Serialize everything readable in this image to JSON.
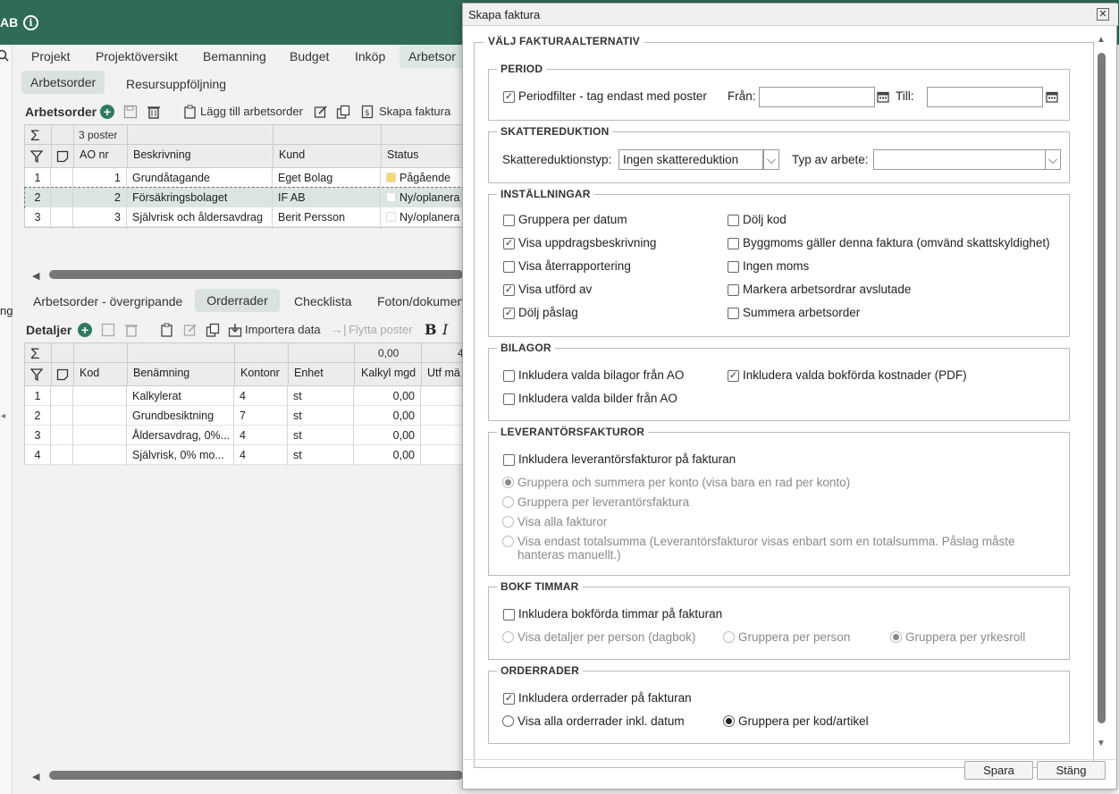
{
  "app": {
    "company": "AB"
  },
  "tabs": [
    "Projekt",
    "Projektöversikt",
    "Bemanning",
    "Budget",
    "Inköp",
    "Arbetsor"
  ],
  "subtabs": [
    "Arbetsorder",
    "Resursuppföljning"
  ],
  "ao_section": {
    "title": "Arbetsorder",
    "add_label": "Lägg till arbetsorder",
    "invoice_label": "Skapa faktura",
    "count": "3 poster",
    "columns": [
      "AO nr",
      "Beskrivning",
      "Kund",
      "Status"
    ],
    "rows": [
      {
        "idx": "1",
        "nr": "1",
        "desc": "Grundåtagande",
        "kund": "Eget Bolag",
        "status": "Pågående",
        "color": "#f1dc6a"
      },
      {
        "idx": "2",
        "nr": "2",
        "desc": "Försäkringsbolaget",
        "kund": "IF AB",
        "status": "Ny/oplanera",
        "color": "#ffffff"
      },
      {
        "idx": "3",
        "nr": "3",
        "desc": "Självrisk och åldersavdrag",
        "kund": "Berit Persson",
        "status": "Ny/oplanera",
        "color": "#ffffff"
      }
    ]
  },
  "detail_tabs": [
    "Arbetsorder - övergripande",
    "Orderrader",
    "Checklista",
    "Foton/dokumen"
  ],
  "detail_section": {
    "title": "Detaljer",
    "import_label": "Importera data",
    "move_label": "Flytta poster",
    "sum_value": "0,00",
    "sum_value2": "4",
    "columns": [
      "Kod",
      "Benämning",
      "Kontonr",
      "Enhet",
      "Kalkyl mgd",
      "Utf mä"
    ],
    "rows": [
      {
        "idx": "1",
        "kod": "",
        "ben": "Kalkylerat",
        "konto": "4",
        "enhet": "st",
        "mgd": "0,00"
      },
      {
        "idx": "2",
        "kod": "",
        "ben": "Grundbesiktning",
        "konto": "7",
        "enhet": "st",
        "mgd": "0,00"
      },
      {
        "idx": "3",
        "kod": "",
        "ben": "Åldersavdrag, 0%...",
        "konto": "4",
        "enhet": "st",
        "mgd": "0,00"
      },
      {
        "idx": "4",
        "kod": "",
        "ben": "Självrisk, 0% mo...",
        "konto": "4",
        "enhet": "st",
        "mgd": "0,00"
      }
    ]
  },
  "left_cut_text": "ng",
  "dialog": {
    "title": "Skapa faktura",
    "main_legend": "VÄLJ FAKTURAALTERNATIV",
    "period": {
      "legend": "PERIOD",
      "filter_label": "Periodfilter - tag endast med poster",
      "from_label": "Från:",
      "to_label": "Till:",
      "from_value": "",
      "to_value": ""
    },
    "tax": {
      "legend": "SKATTEREDUKTION",
      "type_label": "Skattereduktionstyp:",
      "type_value": "Ingen skattereduktion",
      "work_label": "Typ av arbete:",
      "work_value": ""
    },
    "settings": {
      "legend": "INSTÄLLNINGAR",
      "left": [
        {
          "label": "Gruppera per datum",
          "checked": false
        },
        {
          "label": "Visa uppdragsbeskrivning",
          "checked": true
        },
        {
          "label": "Visa återrapportering",
          "checked": false
        },
        {
          "label": "Visa utförd av",
          "checked": true
        },
        {
          "label": "Dölj påslag",
          "checked": true
        }
      ],
      "right": [
        {
          "label": "Dölj kod",
          "checked": false
        },
        {
          "label": "Byggmoms gäller denna faktura (omvänd skattskyldighet)",
          "checked": false
        },
        {
          "label": "Ingen moms",
          "checked": false
        },
        {
          "label": "Markera arbetsordrar avslutade",
          "checked": false
        },
        {
          "label": "Summera arbetsorder",
          "checked": false
        }
      ]
    },
    "attachments": {
      "legend": "BILAGOR",
      "ao_attachments": "Inkludera valda bilagor från AO",
      "booked_costs": "Inkludera valda bokförda kostnader (PDF)",
      "ao_images": "Inkludera valda bilder från AO"
    },
    "supplier": {
      "legend": "LEVERANTÖRSFAKTUROR",
      "include": "Inkludera leverantörsfakturor på fakturan",
      "opt1": "Gruppera och summera per konto (visa bara en rad per konto)",
      "opt2": "Gruppera per leverantörsfaktura",
      "opt3": "Visa alla fakturor",
      "opt4a": "Visa endast totalsumma (Leverantörsfakturor visas enbart som en totalsumma. Påslag måste",
      "opt4b": "hanteras manuellt.)"
    },
    "hours": {
      "legend": "BOKF TIMMAR",
      "include": "Inkludera bokförda timmar på fakturan",
      "opt1": "Visa detaljer per person (dagbok)",
      "opt2": "Gruppera per person",
      "opt3": "Gruppera per yrkesroll"
    },
    "orderrows": {
      "legend": "ORDERRADER",
      "include": "Inkludera orderrader på fakturan",
      "opt1": "Visa alla orderrader inkl. datum",
      "opt2": "Gruppera per kod/artikel"
    },
    "save": "Spara",
    "close": "Stäng"
  }
}
